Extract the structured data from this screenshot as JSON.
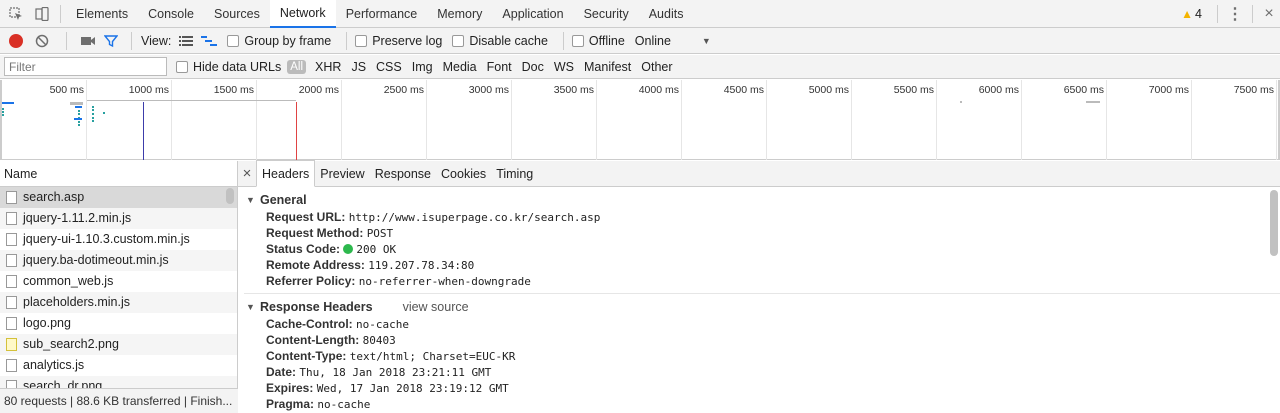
{
  "toolbar": {
    "tabs": [
      "Elements",
      "Console",
      "Sources",
      "Network",
      "Performance",
      "Memory",
      "Application",
      "Security",
      "Audits"
    ],
    "active_tab": "Network",
    "warning_count": "4"
  },
  "controls": {
    "view_label": "View:",
    "group_by_frame": "Group by frame",
    "preserve_log": "Preserve log",
    "disable_cache": "Disable cache",
    "offline": "Offline",
    "throttle": "Online"
  },
  "filters": {
    "placeholder": "Filter",
    "hide_data_urls": "Hide data URLs",
    "types": [
      "All",
      "XHR",
      "JS",
      "CSS",
      "Img",
      "Media",
      "Font",
      "Doc",
      "WS",
      "Manifest",
      "Other"
    ]
  },
  "overview": {
    "ticks": [
      "500 ms",
      "1000 ms",
      "1500 ms",
      "2000 ms",
      "2500 ms",
      "3000 ms",
      "3500 ms",
      "4000 ms",
      "4500 ms",
      "5000 ms",
      "5500 ms",
      "6000 ms",
      "6500 ms",
      "7000 ms",
      "7500 ms"
    ]
  },
  "requests": {
    "header": "Name",
    "items": [
      {
        "name": "search.asp",
        "type": "doc"
      },
      {
        "name": "jquery-1.11.2.min.js",
        "type": "doc"
      },
      {
        "name": "jquery-ui-1.10.3.custom.min.js",
        "type": "doc"
      },
      {
        "name": "jquery.ba-dotimeout.min.js",
        "type": "doc"
      },
      {
        "name": "common_web.js",
        "type": "doc"
      },
      {
        "name": "placeholders.min.js",
        "type": "doc"
      },
      {
        "name": "logo.png",
        "type": "doc"
      },
      {
        "name": "sub_search2.png",
        "type": "img"
      },
      {
        "name": "analytics.js",
        "type": "doc"
      },
      {
        "name": "search_dr.png",
        "type": "doc"
      }
    ],
    "status": "80 requests | 88.6 KB transferred | Finish..."
  },
  "detail": {
    "close": "×",
    "tabs": [
      "Headers",
      "Preview",
      "Response",
      "Cookies",
      "Timing"
    ],
    "active_tab": "Headers",
    "general": {
      "title": "General",
      "rows": [
        {
          "k": "Request URL:",
          "v": "http://www.isuperpage.co.kr/search.asp"
        },
        {
          "k": "Request Method:",
          "v": "POST"
        },
        {
          "k": "Status Code:",
          "v": "200 OK"
        },
        {
          "k": "Remote Address:",
          "v": "119.207.78.34:80"
        },
        {
          "k": "Referrer Policy:",
          "v": "no-referrer-when-downgrade"
        }
      ]
    },
    "response": {
      "title": "Response Headers",
      "view_source": "view source",
      "rows": [
        {
          "k": "Cache-Control:",
          "v": "no-cache"
        },
        {
          "k": "Content-Length:",
          "v": "80403"
        },
        {
          "k": "Content-Type:",
          "v": "text/html; Charset=EUC-KR"
        },
        {
          "k": "Date:",
          "v": "Thu, 18 Jan 2018 23:21:11 GMT"
        },
        {
          "k": "Expires:",
          "v": "Wed, 17 Jan 2018 23:19:12 GMT"
        },
        {
          "k": "Pragma:",
          "v": "no-cache"
        }
      ]
    }
  },
  "colors": {
    "accent": "#1a73e8",
    "record": "#d93025",
    "filter": "#1a73e8",
    "status_ok": "#2db84d",
    "dcl_line": "#3c3caa",
    "load_line": "#e04343",
    "warning": "#f4b400"
  }
}
